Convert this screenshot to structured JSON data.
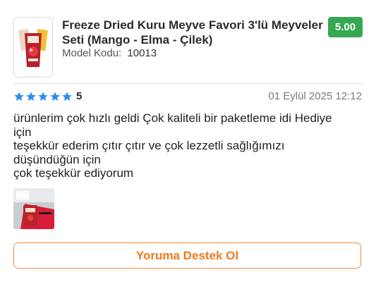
{
  "product": {
    "title_line1": "Freeze Dried Kuru Meyve Favori 3'lü Meyveler",
    "title_line2": "Seti (Mango - Elma - Çilek)",
    "model_label": "Model Kodu:",
    "model_value": "10013",
    "price": "5.00",
    "price_color": "#36a852"
  },
  "review": {
    "stars": 5,
    "rating": "5",
    "star_color": "#2d8cf0",
    "date": "01 Eylül 2025 12:12",
    "lines": [
      "ürünlerim çok hızlı geldi Çok kaliteli bir paketleme idi Hediye",
      "için",
      "teşekkür ederim çıtır çıtır ve çok lezzetli sağlığımızı",
      "düşündüğün için",
      "çok teşekkür ediyorum"
    ]
  },
  "actions": {
    "support_label": "Yoruma Destek Ol",
    "accent_color": "#f58a32"
  }
}
